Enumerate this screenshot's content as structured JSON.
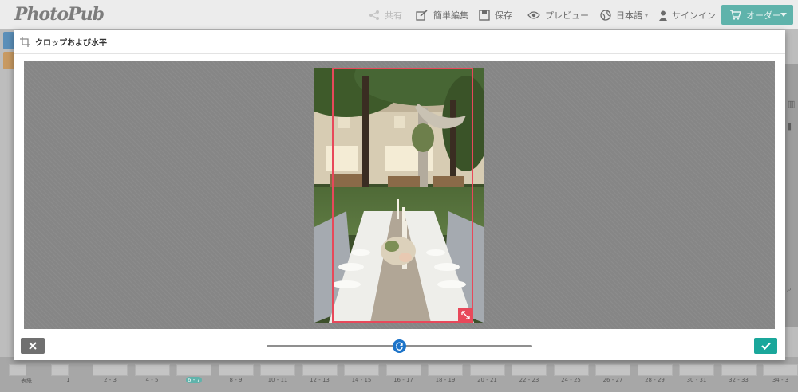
{
  "app": {
    "logo_text": "PhotoPub",
    "header": {
      "share_label": "共有",
      "easy_edit_label": "簡単編集",
      "save_label": "保存",
      "preview_label": "プレビュー",
      "language_label": "日本語",
      "signin_label": "サインイン",
      "order_label": "オーダー"
    },
    "accent_color": "#5fb3ab"
  },
  "crop_dialog": {
    "title": "クロップおよび水平",
    "frame_color": "#e8485a",
    "confirm_color": "#1aa79b",
    "rotation_slider": {
      "value": 0.5
    },
    "icons": {
      "title": "crop-icon",
      "close": "close-icon",
      "confirm": "check-icon",
      "resize": "resize-arrows-icon",
      "rotate": "rotate-icon"
    }
  },
  "page_strip": {
    "pages": [
      "表紙",
      "1",
      "2 - 3",
      "4 - 5",
      "6 - 7",
      "8 - 9",
      "10 - 11",
      "12 - 13",
      "14 - 15",
      "16 - 17",
      "18 - 19",
      "20 - 21",
      "22 - 23",
      "24 - 25",
      "26 - 27",
      "28 - 29",
      "30 - 31",
      "32 - 33",
      "34 - 3"
    ],
    "current_page": "6 - 7"
  }
}
